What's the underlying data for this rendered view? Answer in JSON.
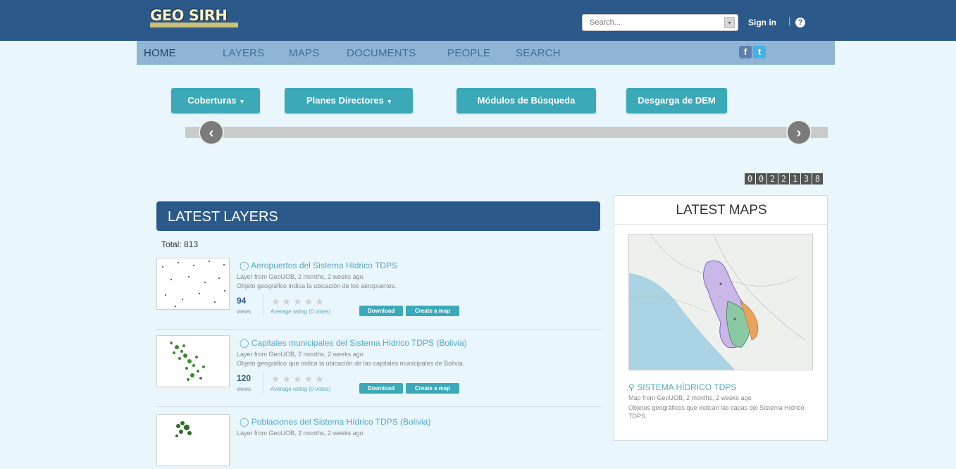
{
  "header": {
    "logo_text": "GEO SIRH",
    "search_placeholder": "Search...",
    "signin": "Sign in",
    "separator": "|",
    "help": "?"
  },
  "nav": {
    "items": [
      {
        "label": "HOME",
        "active": true
      },
      {
        "label": "LAYERS"
      },
      {
        "label": "MAPS"
      },
      {
        "label": "DOCUMENTS"
      },
      {
        "label": "PEOPLE"
      },
      {
        "label": "SEARCH"
      }
    ],
    "social": [
      {
        "name": "facebook-icon",
        "glyph": "f"
      },
      {
        "name": "twitter-icon",
        "glyph": "t"
      }
    ]
  },
  "quick_buttons": [
    {
      "label": "Coberturas",
      "caret": "▾"
    },
    {
      "label": "Planes Directores",
      "caret": "▾"
    },
    {
      "label": "Módulos de Búsqueda"
    },
    {
      "label": "Desgarga de DEM"
    }
  ],
  "slider": {
    "prev": "‹",
    "next": "›"
  },
  "counter": [
    "0",
    "0",
    "2",
    "2",
    "1",
    "3",
    "8"
  ],
  "latest_layers": {
    "title": "LATEST LAYERS",
    "total": "Total: 813",
    "items": [
      {
        "title": "Aeropuertos del Sistema Hídrico TDPS",
        "meta": "Layer from GeoUOB, 2 months, 2 weeks ago",
        "desc": "Objeto geográfico indica la ubicación de los aeropuertos.",
        "views": "94",
        "views_label": "views",
        "rating": "Average rating (0 votes)",
        "download": "Download",
        "create_map": "Create a map"
      },
      {
        "title": "Capitales municipales del Sistema Hídrico TDPS (Bolivia)",
        "meta": "Layer from GeoUOB, 2 months, 2 weeks ago",
        "desc": "Objeto geográfico que indica la ubicación de las capitales municipales de Bolivia.",
        "views": "120",
        "views_label": "views",
        "rating": "Average rating (0 votes)",
        "download": "Download",
        "create_map": "Create a map"
      },
      {
        "title": "Poblaciones del Sistema Hídrico TDPS (Bolivia)",
        "meta": "Layer from GeoUOB, 2 months, 2 weeks ago"
      }
    ]
  },
  "latest_maps": {
    "title": "LATEST MAPS",
    "item": {
      "title": "SISTEMA HÍDRICO TDPS",
      "meta": "Map from GeoUOB, 2 months, 2 weeks ago",
      "desc": "Objetos geográficos que indican las capas del Sistema Hídrico TDPS."
    }
  },
  "colors": {
    "header_bg": "#2b5a8a",
    "nav_bg": "#8fb4d4",
    "teal": "#3ba9b7",
    "page_bg": "#e9f6fb",
    "link": "#55a8c8"
  }
}
